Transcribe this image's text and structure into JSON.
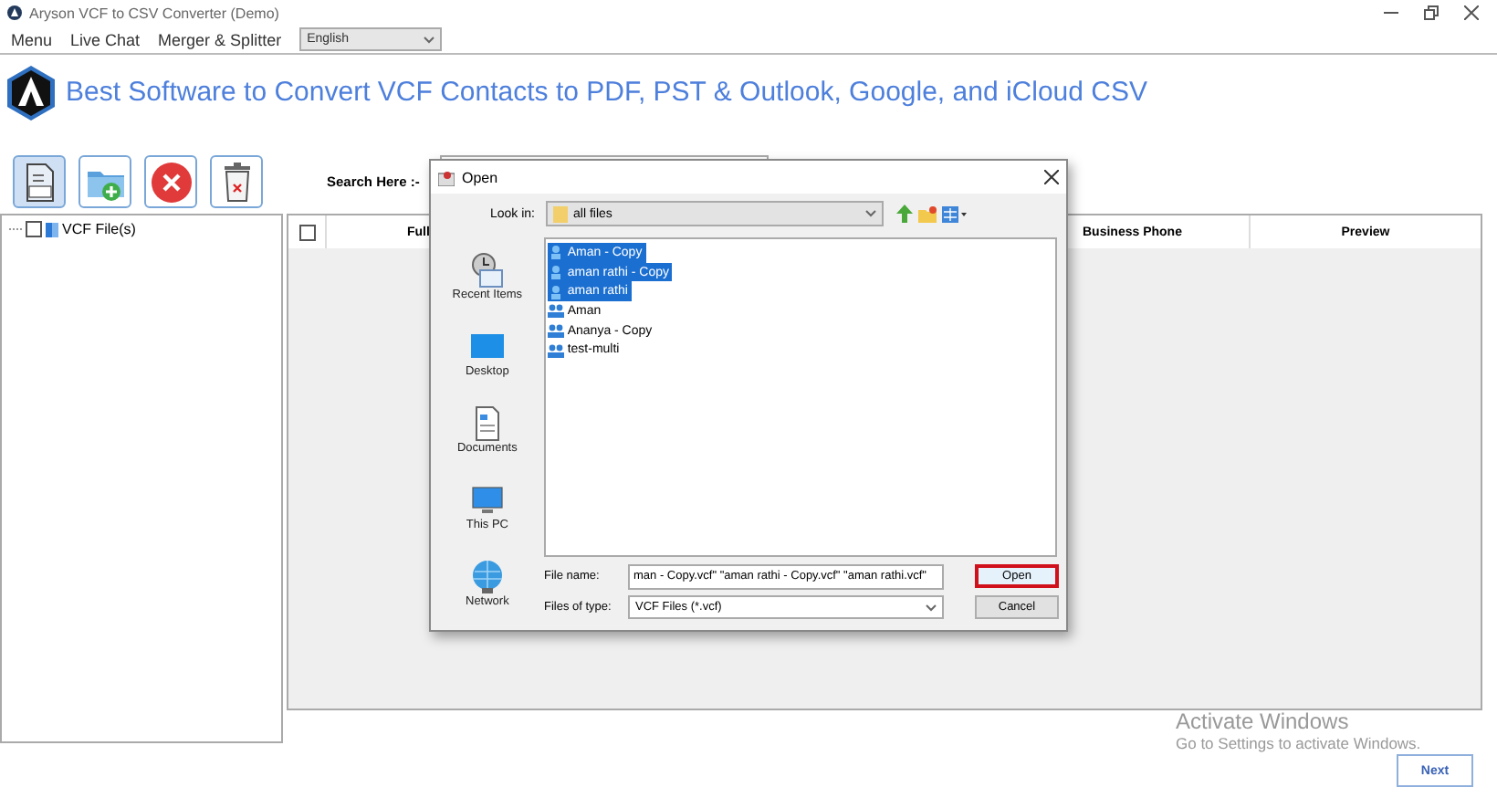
{
  "window": {
    "title": "Aryson VCF to CSV Converter (Demo)"
  },
  "menu": [
    {
      "label": "Menu"
    },
    {
      "label": "Live Chat"
    },
    {
      "label": "Merger & Splitter"
    }
  ],
  "language_select": {
    "value": "English"
  },
  "header": {
    "heading": "Best Software to Convert VCF Contacts to PDF, PST & Outlook, Google, and iCloud CSV"
  },
  "toolbar": [
    {
      "kind": "vcf"
    },
    {
      "kind": "add-folder"
    },
    {
      "kind": "remove"
    },
    {
      "kind": "delete"
    }
  ],
  "search": {
    "label": "Search Here :-"
  },
  "tree": [
    {
      "label": "VCF File(s)",
      "checked": false
    }
  ],
  "table": {
    "header_checkbox": {
      "checked": false
    },
    "columns": [
      "Full",
      "Business Phone",
      "Preview"
    ]
  },
  "next_button": {
    "label": "Next"
  },
  "dialog": {
    "title": "Open",
    "look_in_label": "Look in:",
    "look_in": "all files",
    "places": [
      {
        "label": "Recent Items",
        "kind": "recent"
      },
      {
        "label": "Desktop",
        "kind": "desktop"
      },
      {
        "label": "Documents",
        "kind": "documents"
      },
      {
        "label": "This PC",
        "kind": "pc"
      },
      {
        "label": "Network",
        "kind": "network"
      }
    ],
    "files": [
      {
        "name": "Aman - Copy",
        "selected": true
      },
      {
        "name": "aman rathi - Copy",
        "selected": true
      },
      {
        "name": "aman rathi",
        "selected": true
      },
      {
        "name": "Aman",
        "selected": false
      },
      {
        "name": "Ananya - Copy",
        "selected": false
      },
      {
        "name": "test-multi",
        "selected": false
      }
    ],
    "file_name_label": "File name:",
    "file_name": "man - Copy.vcf\" \"aman rathi - Copy.vcf\" \"aman rathi.vcf\"",
    "file_type_label": "Files of type:",
    "file_type": "VCF Files (*.vcf)",
    "buttons": [
      {
        "label": "Open",
        "focused": true
      },
      {
        "label": "Cancel",
        "focused": false
      }
    ]
  },
  "activation_notice": {
    "title": "Activate Windows",
    "message": "Go to Settings to activate Windows."
  }
}
